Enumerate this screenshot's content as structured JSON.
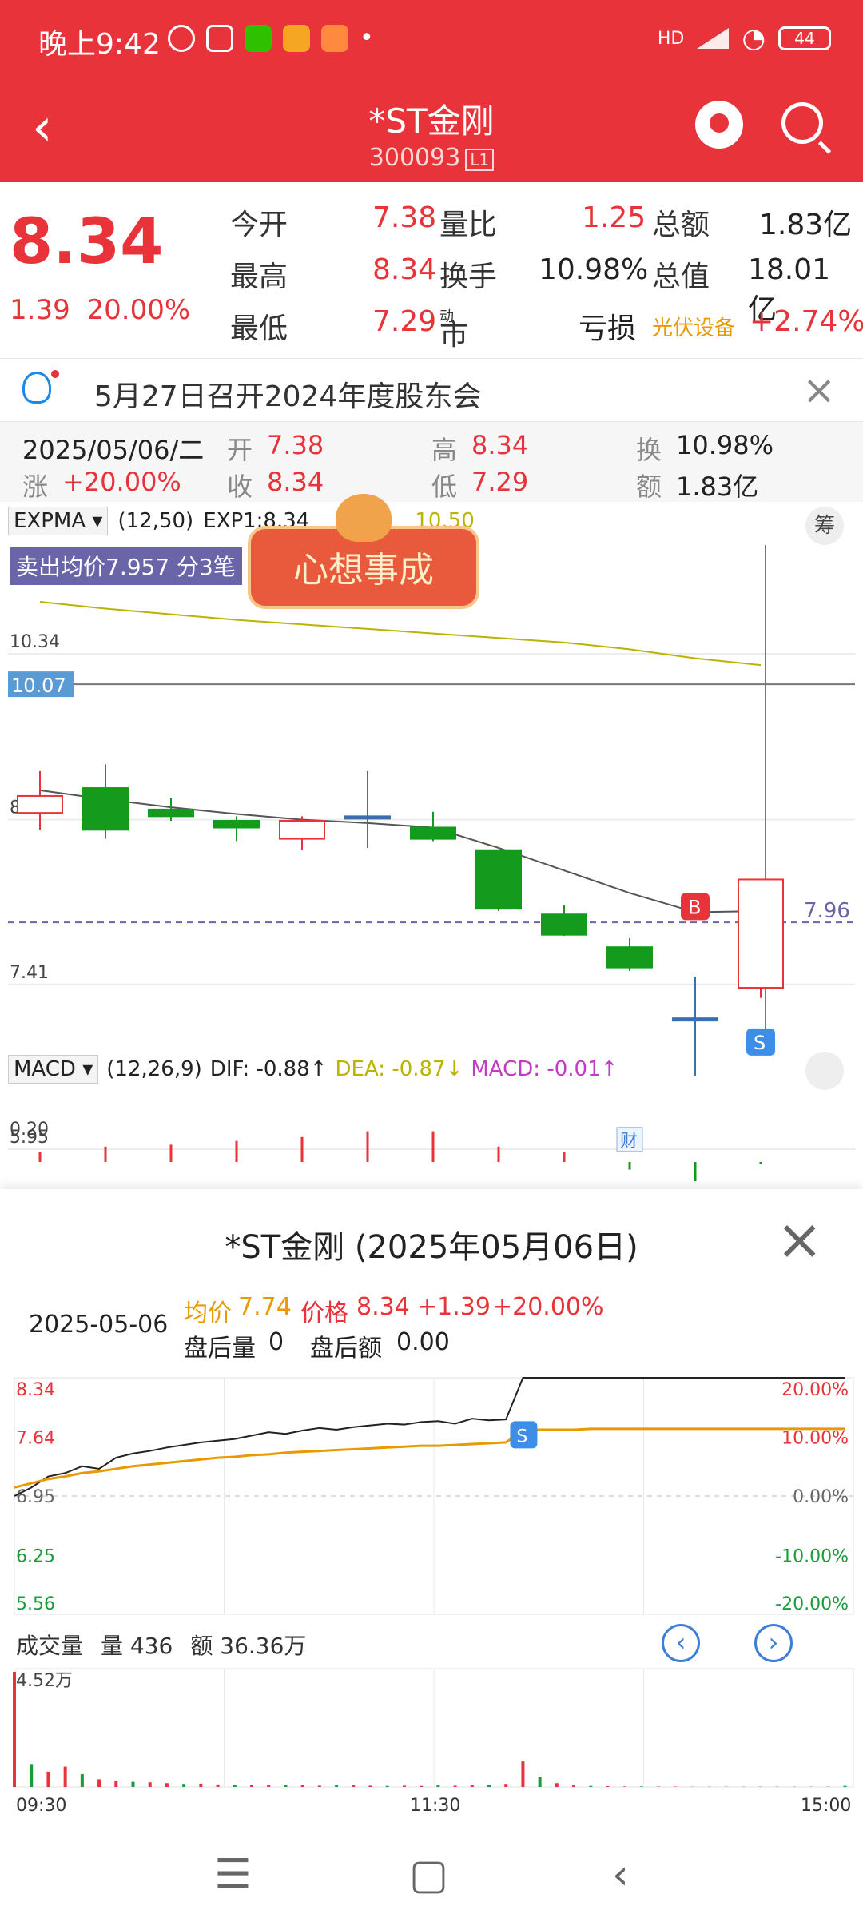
{
  "status": {
    "time": "晚上9:42",
    "network": "HD",
    "battery": "44",
    "app_icons": [
      "alarm-icon",
      "nfc-icon",
      "wechat-icon",
      "video-app-icon",
      "game-app-icon"
    ]
  },
  "header": {
    "title": "*ST金刚",
    "code": "300093",
    "level": "L1"
  },
  "quote": {
    "price": "8.34",
    "change": "1.39",
    "change_pct": "20.00%",
    "rows": [
      {
        "l1": "今开",
        "v1": "7.38",
        "l2": "量比",
        "v2": "1.25",
        "l3": "总额",
        "v3": "1.83亿"
      },
      {
        "l1": "最高",
        "v1": "8.34",
        "l2": "换手",
        "v2": "10.98%",
        "l3": "总值",
        "v3": "18.01亿"
      },
      {
        "l1": "最低",
        "v1": "7.29",
        "l2": "市盈",
        "l2sup": "动",
        "v2": "亏损",
        "l3": "光伏设备",
        "v3": "+2.74%"
      }
    ]
  },
  "notice": {
    "text": "5月27日召开2024年度股东会"
  },
  "info": {
    "date": "2025/05/06/二",
    "open_label": "开",
    "open": "7.38",
    "high_label": "高",
    "high": "8.34",
    "turn_label": "换",
    "turn": "10.98%",
    "chg_label": "涨",
    "chg": "+20.00%",
    "close_label": "收",
    "close": "8.34",
    "low_label": "低",
    "low": "7.29",
    "amt_label": "额",
    "amt": "1.83亿"
  },
  "kchart": {
    "indicator": "EXPMA",
    "params": "(12,50)",
    "exp1": "EXP1:8.34",
    "exp2": "10.50",
    "chou": "筹",
    "sell_badge": "卖出均价7.957 分3笔",
    "banner": "心想事成",
    "price_levels": [
      "10.34",
      "8.87",
      "7.41",
      "5.95"
    ],
    "crosshair_price": "10.07",
    "marker_price": "7.96",
    "buy_label": "B",
    "sell_label": "S",
    "fin_label": "财",
    "macd_label": "MACD",
    "macd_params": "(12,26,9)",
    "dif": "DIF: -0.88↑",
    "dea": "DEA: -0.87↓",
    "macd": "MACD: -0.01↑",
    "macd_level": "0.20"
  },
  "chart_data": {
    "type": "candlestick",
    "candles": [
      {
        "o": 8.93,
        "c": 9.08,
        "h": 9.3,
        "l": 8.78
      },
      {
        "o": 9.15,
        "c": 8.78,
        "h": 9.36,
        "l": 8.7
      },
      {
        "o": 8.96,
        "c": 8.9,
        "h": 9.06,
        "l": 8.86
      },
      {
        "o": 8.86,
        "c": 8.8,
        "h": 8.9,
        "l": 8.68
      },
      {
        "o": 8.7,
        "c": 8.86,
        "h": 8.9,
        "l": 8.6
      },
      {
        "o": 8.9,
        "c": 8.9,
        "h": 9.3,
        "l": 8.62
      },
      {
        "o": 8.8,
        "c": 8.7,
        "h": 8.94,
        "l": 8.68
      },
      {
        "o": 8.6,
        "c": 8.08,
        "h": 8.6,
        "l": 8.06
      },
      {
        "o": 8.03,
        "c": 7.85,
        "h": 8.11,
        "l": 7.84
      },
      {
        "o": 7.74,
        "c": 7.56,
        "h": 7.82,
        "l": 7.53
      },
      {
        "o": 7.11,
        "c": 7.11,
        "h": 7.48,
        "l": 6.6
      },
      {
        "o": 7.38,
        "c": 8.34,
        "h": 8.34,
        "l": 7.29
      }
    ],
    "expma_series": [
      9.13,
      9.05,
      8.98,
      8.92,
      8.87,
      8.84,
      8.8,
      8.62,
      8.42,
      8.22,
      8.05,
      8.06
    ],
    "expma2_series": [
      10.8,
      10.74,
      10.69,
      10.64,
      10.6,
      10.56,
      10.52,
      10.48,
      10.44,
      10.38,
      10.3,
      10.24
    ],
    "macd_bars": [
      0.05,
      0.08,
      0.09,
      0.11,
      0.13,
      0.16,
      0.16,
      0.08,
      0.05,
      -0.04,
      -0.1,
      -0.01
    ],
    "ylim": [
      5.95,
      10.34
    ]
  },
  "panel": {
    "title": "*ST金刚 (2025年05月06日)",
    "date": "2025-05-06",
    "avg_label": "均价",
    "avg": "7.74",
    "price_label": "价格",
    "price": "8.34",
    "chg": "+1.39",
    "chg_pct": "+20.00%",
    "after_vol_label": "盘后量",
    "after_vol": "0",
    "after_amt_label": "盘后额",
    "after_amt": "0.00",
    "left_axis": [
      "8.34",
      "7.64",
      "6.95",
      "6.25",
      "5.56"
    ],
    "right_axis": [
      "20.00%",
      "10.00%",
      "0.00%",
      "-10.00%",
      "-20.00%"
    ],
    "sell_marker": "S",
    "vol_label": "成交量",
    "vol": "量 436",
    "amt": "额 36.36万",
    "vol_max": "4.52万",
    "time_axis": [
      "09:30",
      "11:30",
      "15:00"
    ]
  },
  "intraday": {
    "price": [
      6.95,
      7.05,
      7.18,
      7.22,
      7.3,
      7.27,
      7.4,
      7.45,
      7.48,
      7.52,
      7.55,
      7.58,
      7.6,
      7.62,
      7.66,
      7.7,
      7.68,
      7.72,
      7.75,
      7.73,
      7.76,
      7.78,
      7.8,
      7.79,
      7.82,
      7.83,
      7.8,
      7.86,
      7.84,
      7.85,
      8.34,
      8.34,
      8.34,
      8.34,
      8.34,
      8.34,
      8.34,
      8.34,
      8.34,
      8.34,
      8.34,
      8.34,
      8.34,
      8.34,
      8.34,
      8.34,
      8.34,
      8.34,
      8.34,
      8.34
    ],
    "avg": [
      7.05,
      7.1,
      7.15,
      7.18,
      7.22,
      7.24,
      7.27,
      7.3,
      7.32,
      7.34,
      7.36,
      7.38,
      7.4,
      7.41,
      7.43,
      7.44,
      7.46,
      7.47,
      7.48,
      7.49,
      7.5,
      7.51,
      7.52,
      7.53,
      7.54,
      7.54,
      7.55,
      7.56,
      7.57,
      7.58,
      7.72,
      7.73,
      7.73,
      7.73,
      7.74,
      7.74,
      7.74,
      7.74,
      7.74,
      7.74,
      7.74,
      7.74,
      7.74,
      7.74,
      7.74,
      7.74,
      7.74,
      7.74,
      7.74,
      7.74
    ],
    "volume": [
      45200,
      9000,
      6000,
      8000,
      5000,
      3000,
      2500,
      2000,
      1800,
      1500,
      1200,
      1300,
      1000,
      900,
      800,
      700,
      900,
      600,
      500,
      700,
      600,
      500,
      400,
      500,
      400,
      600,
      500,
      700,
      900,
      1200,
      10000,
      4000,
      1500,
      600,
      400,
      300,
      200,
      200,
      150,
      150,
      100,
      100,
      100,
      100,
      100,
      100,
      100,
      100,
      100,
      436
    ]
  }
}
